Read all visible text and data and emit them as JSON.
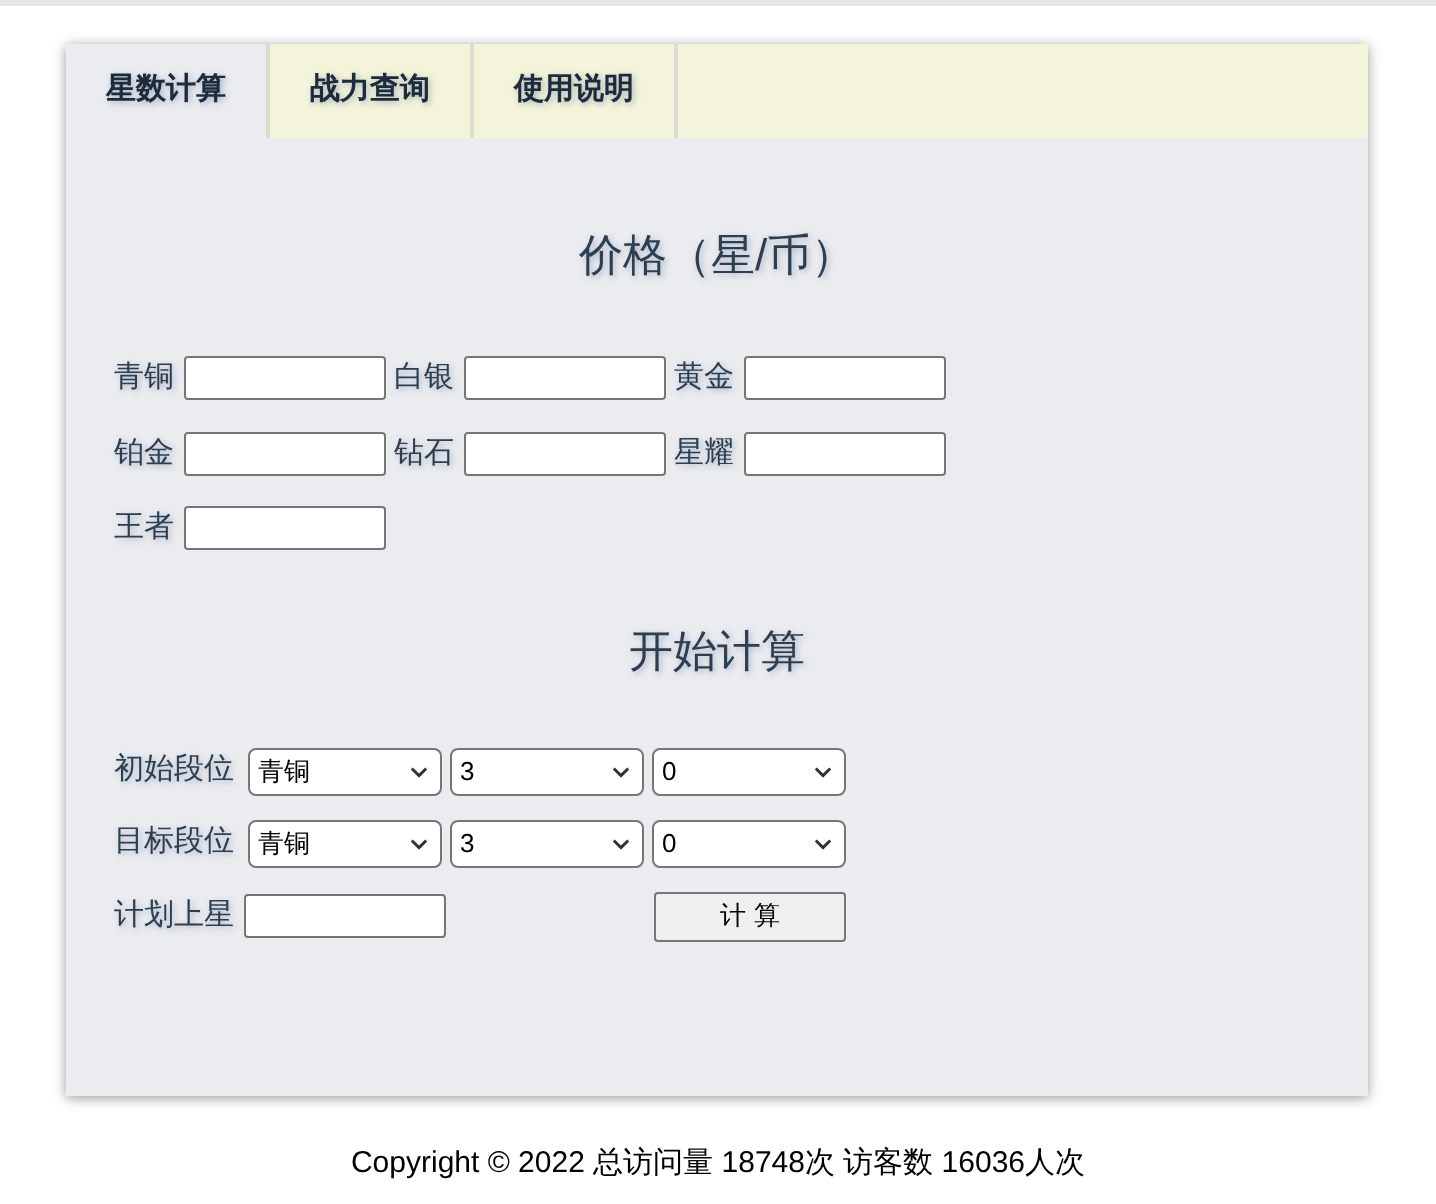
{
  "tabs": [
    {
      "label": "星数计算",
      "selected": true
    },
    {
      "label": "战力查询",
      "selected": false
    },
    {
      "label": "使用说明",
      "selected": false
    }
  ],
  "price_section": {
    "title": "价格（星/币）",
    "fields": [
      {
        "label": "青铜"
      },
      {
        "label": "白银"
      },
      {
        "label": "黄金"
      },
      {
        "label": "铂金"
      },
      {
        "label": "钻石"
      },
      {
        "label": "星耀"
      },
      {
        "label": "王者"
      }
    ]
  },
  "calc_section": {
    "title": "开始计算",
    "rank_rows": [
      {
        "label": "初始段位",
        "selects": [
          "青铜",
          "3",
          "0"
        ]
      },
      {
        "label": "目标段位",
        "selects": [
          "青铜",
          "3",
          "0"
        ]
      }
    ],
    "plan": {
      "label": "计划上星"
    },
    "button": "计 算"
  },
  "footer": "Copyright © 2022 总访问量 18748次 访客数 16036人次"
}
